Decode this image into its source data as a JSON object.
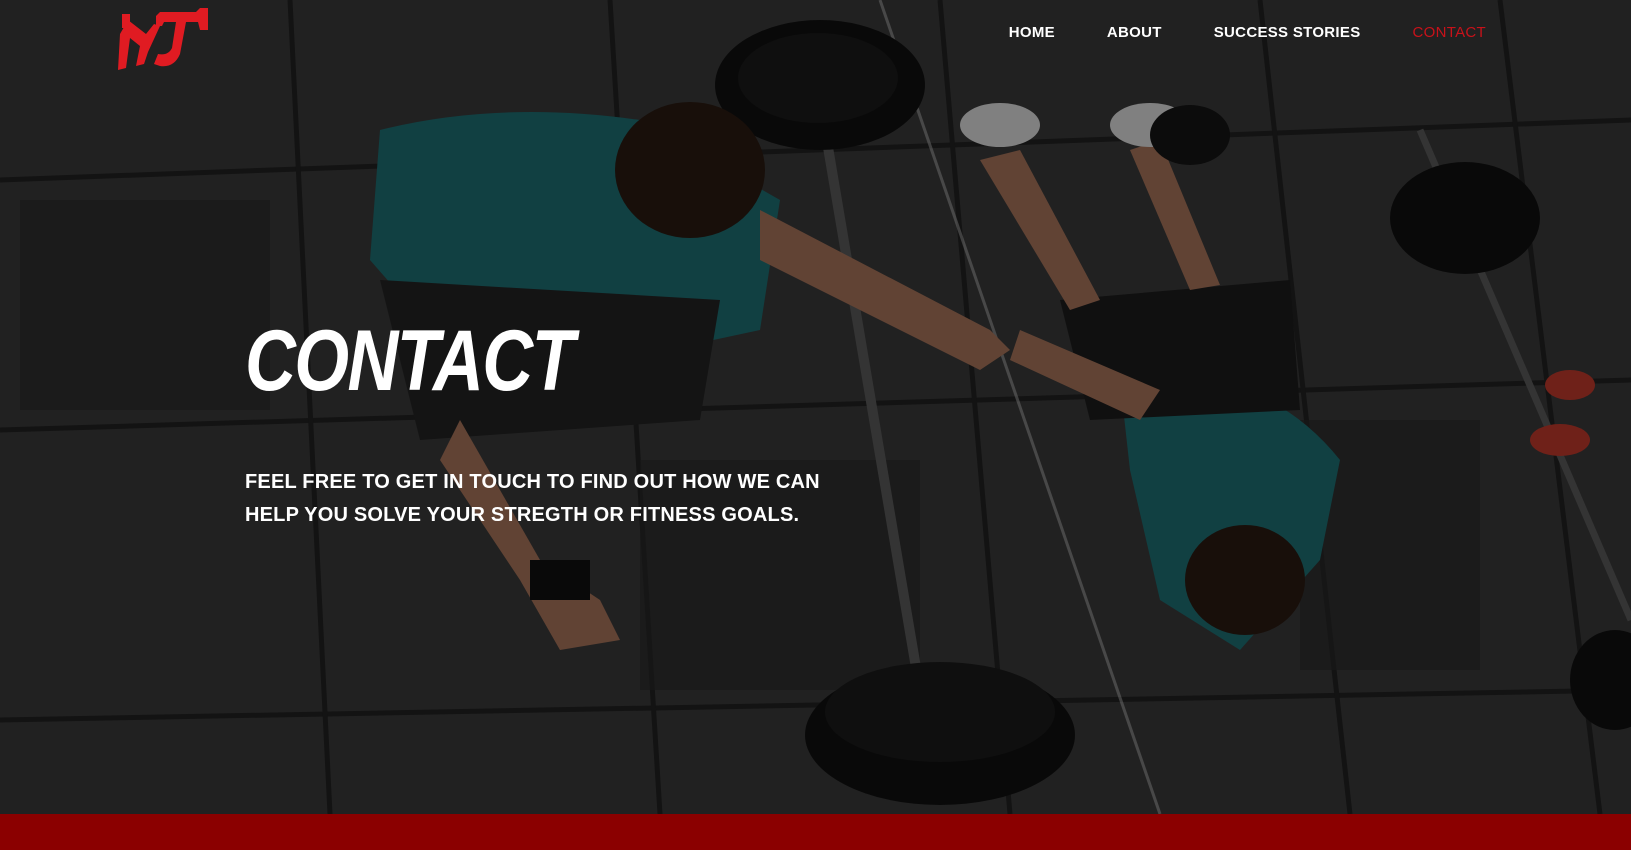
{
  "colors": {
    "accent": "#c8121a",
    "footer_bar": "#8b0000",
    "nav_text": "#ffffff"
  },
  "header": {
    "logo_icon": "dumbbell-logo-icon",
    "nav": [
      {
        "label": "HOME",
        "active": false
      },
      {
        "label": "ABOUT",
        "active": false
      },
      {
        "label": "SUCCESS STORIES",
        "active": false
      },
      {
        "label": "CONTACT",
        "active": true
      }
    ]
  },
  "hero": {
    "title": "CONTACT",
    "subtitle_line1": "FEEL FREE TO GET IN TOUCH TO FIND OUT HOW WE CAN",
    "subtitle_line2": "HELP YOU SOLVE YOUR STREGTH OR FITNESS GOALS.",
    "background_image": "gym-athletes-fist-bump-photo"
  }
}
